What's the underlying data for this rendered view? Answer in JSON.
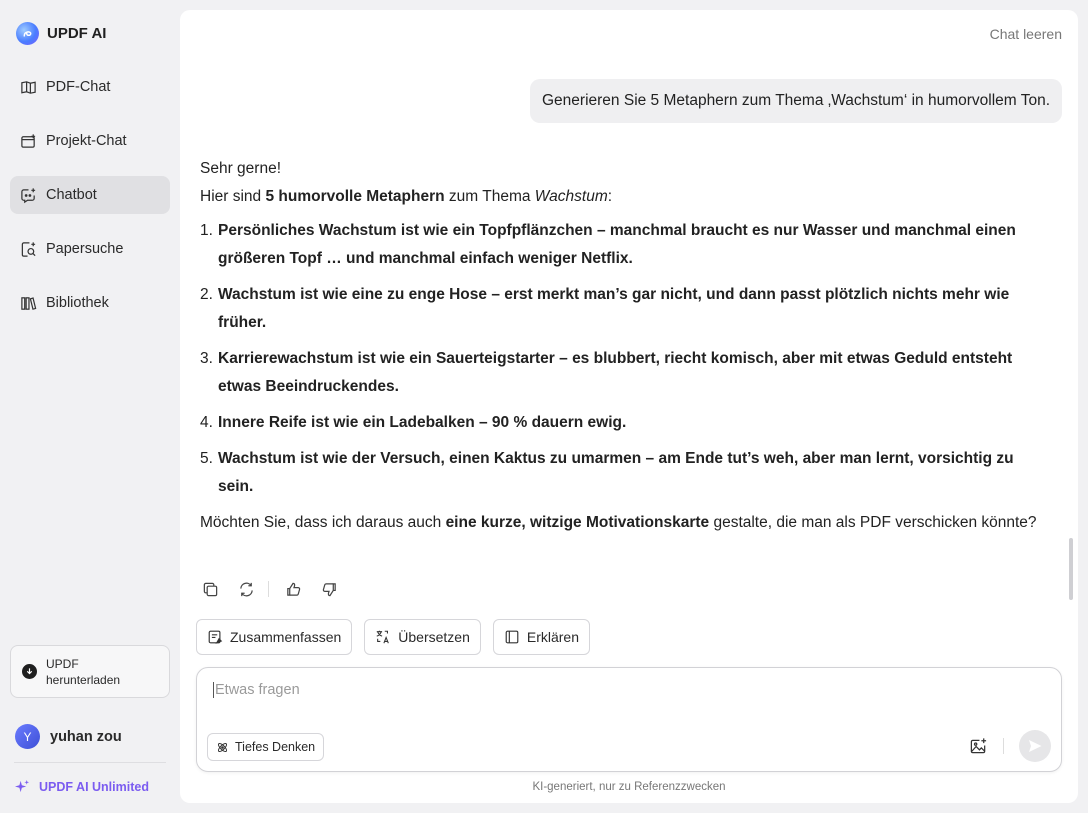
{
  "brand": {
    "name": "UPDF AI"
  },
  "sidebar": {
    "items": [
      {
        "label": "PDF-Chat",
        "icon": "book-open-icon",
        "active": false
      },
      {
        "label": "Projekt-Chat",
        "icon": "folder-icon",
        "active": false
      },
      {
        "label": "Chatbot",
        "icon": "chatbot-icon",
        "active": true
      },
      {
        "label": "Papersuche",
        "icon": "search-paper-icon",
        "active": false
      },
      {
        "label": "Bibliothek",
        "icon": "library-icon",
        "active": false
      }
    ],
    "download_label": "UPDF herunterladen",
    "user_initial": "Y",
    "user_name": "yuhan zou",
    "unlimited_label": "UPDF AI Unlimited"
  },
  "header": {
    "clear_label": "Chat leeren"
  },
  "chat": {
    "user_message": "Generieren Sie 5 Metaphern zum Thema ‚Wachstum‘ in humorvollem Ton.",
    "answer": {
      "greeting": "Sehr gerne!",
      "intro_prefix": "Hier sind ",
      "intro_bold": "5 humorvolle Metaphern",
      "intro_middle": " zum Thema ",
      "intro_italic": "Wachstum",
      "intro_suffix": ":",
      "items": [
        {
          "num": "1.",
          "text": "Persönliches Wachstum ist wie ein Topfpflänzchen – manchmal braucht es nur Wasser und manchmal einen größeren Topf … und manchmal einfach weniger Netflix."
        },
        {
          "num": "2.",
          "text": "Wachstum ist wie eine zu enge Hose – erst merkt man’s gar nicht, und dann passt plötzlich nichts mehr wie früher."
        },
        {
          "num": "3.",
          "text": "Karrierewachstum ist wie ein Sauerteigstarter – es blubbert, riecht komisch, aber mit etwas Geduld entsteht etwas Beeindruckendes."
        },
        {
          "num": "4.",
          "text": "Innere Reife ist wie ein Ladebalken – 90 % dauern ewig."
        },
        {
          "num": "5.",
          "text": "Wachstum ist wie der Versuch, einen Kaktus zu umarmen – am Ende tut’s weh, aber man lernt, vorsichtig zu sein."
        }
      ],
      "outro_prefix": "Möchten Sie, dass ich daraus auch ",
      "outro_bold": "eine kurze, witzige Motivationskarte",
      "outro_suffix": " gestalte, die man als PDF verschicken könnte?"
    }
  },
  "quick_actions": [
    {
      "label": "Zusammenfassen",
      "icon": "summarize-icon"
    },
    {
      "label": "Übersetzen",
      "icon": "translate-icon"
    },
    {
      "label": "Erklären",
      "icon": "explain-icon"
    }
  ],
  "composer": {
    "placeholder": "Etwas fragen",
    "value": "",
    "deep_think_label": "Tiefes Denken"
  },
  "disclaimer": "KI-generiert, nur zu Referenzzwecken"
}
